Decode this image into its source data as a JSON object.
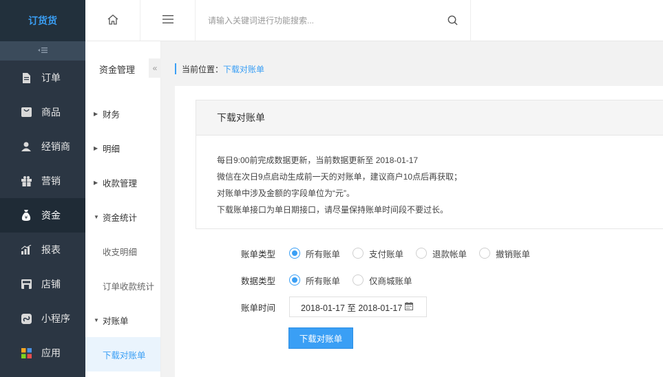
{
  "app": {
    "logo_text": "订货货"
  },
  "sidebar": {
    "items": [
      {
        "label": "订单",
        "icon": "document-icon"
      },
      {
        "label": "商品",
        "icon": "bag-icon"
      },
      {
        "label": "经销商",
        "icon": "user-icon"
      },
      {
        "label": "营销",
        "icon": "gift-icon"
      },
      {
        "label": "资金",
        "icon": "money-bag-icon",
        "active": true
      },
      {
        "label": "报表",
        "icon": "bar-chart-icon"
      },
      {
        "label": "店铺",
        "icon": "store-icon"
      },
      {
        "label": "小程序",
        "icon": "mini-program-icon"
      },
      {
        "label": "应用",
        "icon": "apps-icon"
      }
    ]
  },
  "topbar": {
    "search": {
      "placeholder": "请输入关键词进行功能搜索..."
    }
  },
  "subsidebar": {
    "title": "资金管理",
    "collapse_glyph": "«",
    "items": [
      {
        "label": "财务",
        "arrow": "▶"
      },
      {
        "label": "明细",
        "arrow": "▶"
      },
      {
        "label": "收款管理",
        "arrow": "▶"
      },
      {
        "label": "资金统计",
        "arrow": "▼"
      },
      {
        "label": "收支明细"
      },
      {
        "label": "订单收款统计"
      },
      {
        "label": "对账单",
        "arrow": "▼"
      },
      {
        "label": "下载对账单",
        "selected": true
      }
    ]
  },
  "breadcrumb": {
    "prefix": "当前位置：",
    "current": "下载对账单"
  },
  "panel": {
    "title": "下载对账单",
    "lines": [
      "每日9:00前完成数据更新，当前数据更新至 2018-01-17",
      "微信在次日9点启动生成前一天的对账单，建议商户10点后再获取；",
      "对账单中涉及金额的字段单位为“元”。",
      "下载账单接口为单日期接口，请尽量保持账单时间段不要过长。"
    ]
  },
  "form": {
    "bill_type": {
      "label": "账单类型",
      "options": [
        "所有账单",
        "支付账单",
        "退款帐单",
        "撤销账单"
      ],
      "selected": "所有账单"
    },
    "data_type": {
      "label": "数据类型",
      "options": [
        "所有账单",
        "仅商城账单"
      ],
      "selected": "所有账单"
    },
    "bill_time": {
      "label": "账单时间",
      "value": "2018-01-17 至 2018-01-17"
    },
    "download_label": "下载对账单"
  },
  "colors": {
    "accent": "#3a9ff5",
    "sidebar_bg": "#2b3643"
  }
}
